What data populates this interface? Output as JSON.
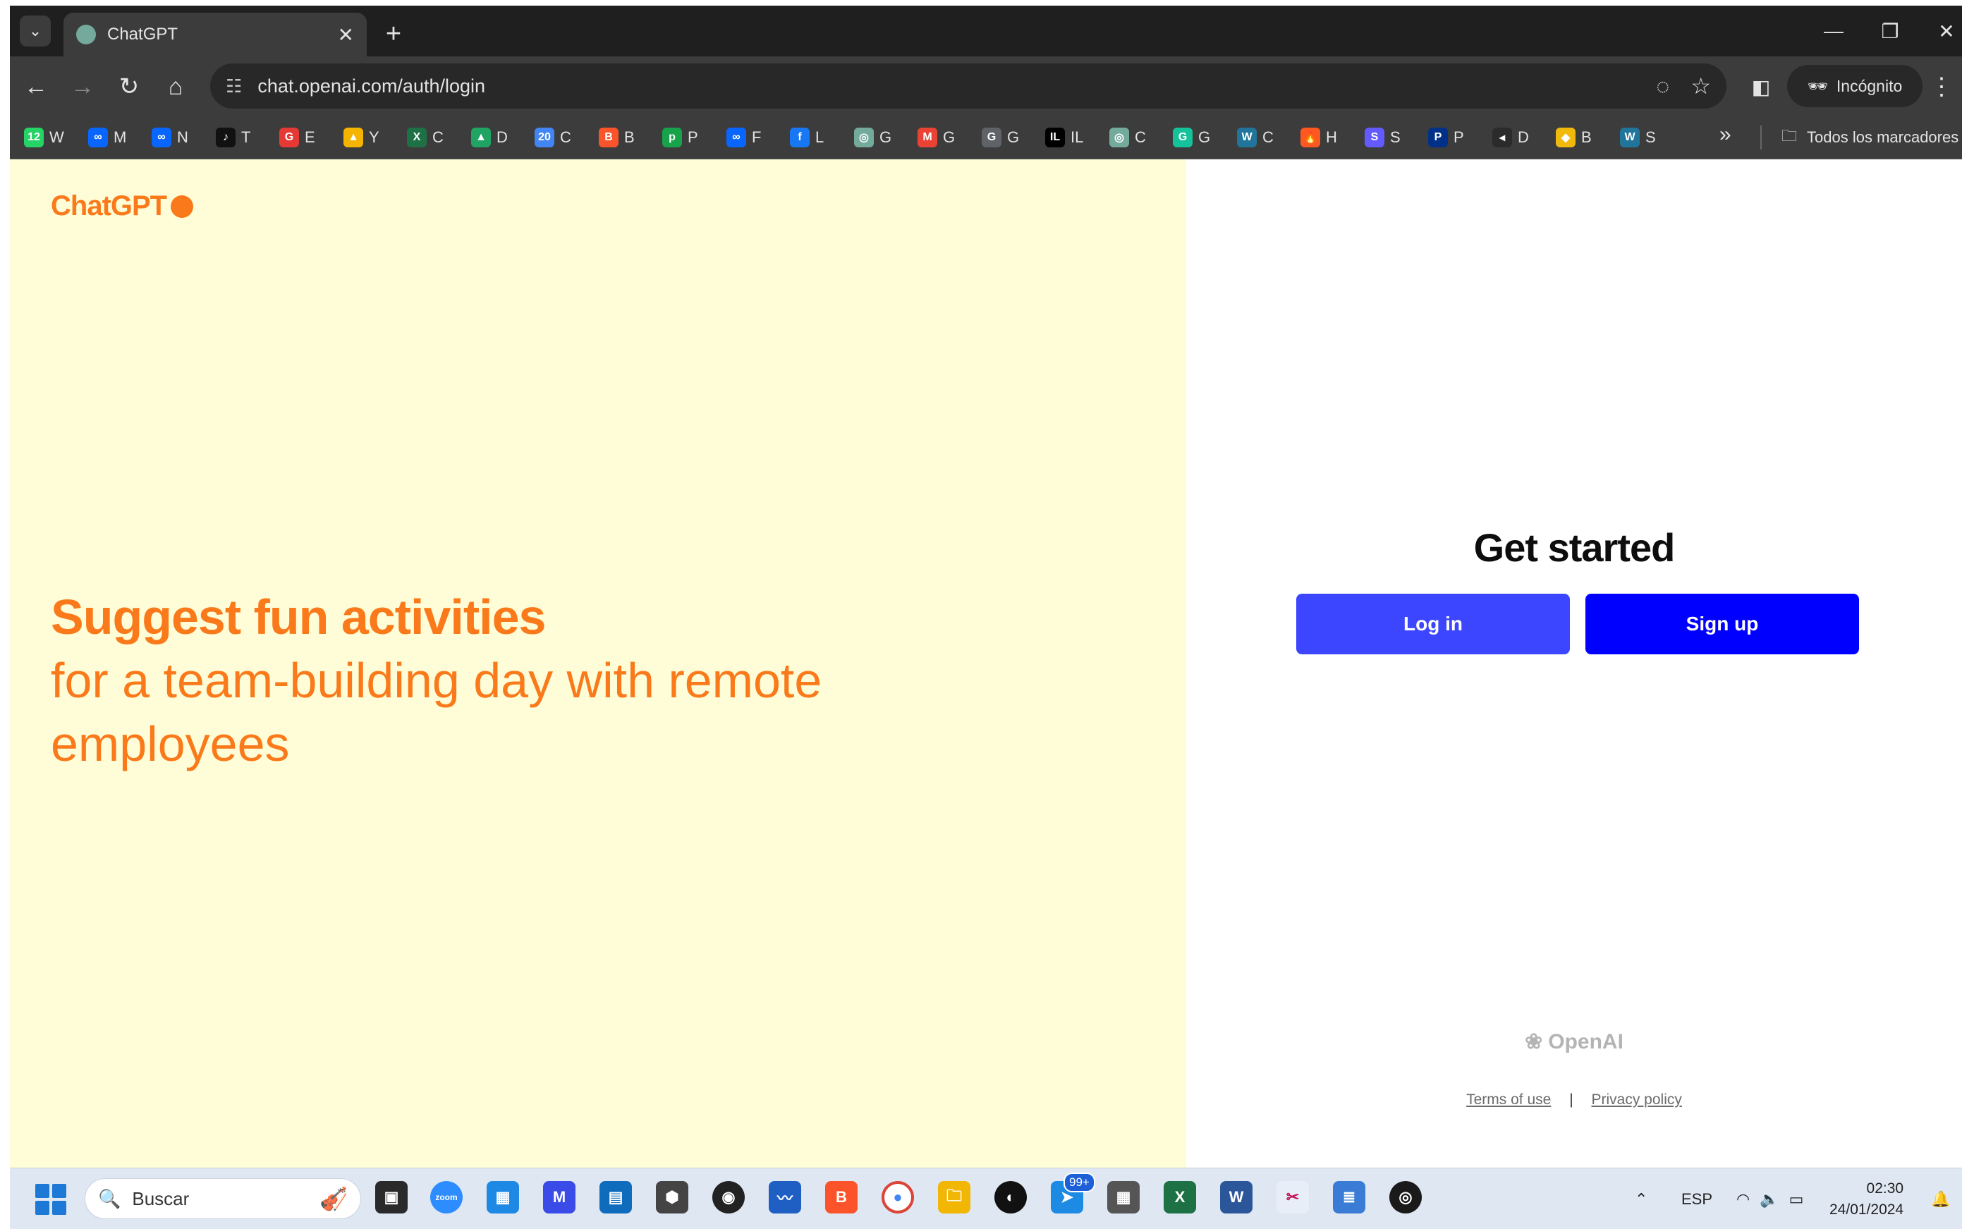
{
  "browser": {
    "tab_title": "ChatGPT",
    "url": "chat.openai.com/auth/login",
    "incognito_label": "Incógnito",
    "bookmarks": [
      {
        "label": "W",
        "icon": "whatsapp-icon",
        "color": "#25d366",
        "glyph": "12"
      },
      {
        "label": "M",
        "icon": "meta-icon",
        "color": "#0866ff",
        "glyph": "∞"
      },
      {
        "label": "N",
        "icon": "meta-icon",
        "color": "#0866ff",
        "glyph": "∞"
      },
      {
        "label": "T",
        "icon": "tiktok-icon",
        "color": "#111111",
        "glyph": "♪"
      },
      {
        "label": "E",
        "icon": "g-red-icon",
        "color": "#e53935",
        "glyph": "G"
      },
      {
        "label": "Y",
        "icon": "image-icon",
        "color": "#f5b400",
        "glyph": "▲"
      },
      {
        "label": "C",
        "icon": "spreadsheet-icon",
        "color": "#1e7145",
        "glyph": "X"
      },
      {
        "label": "D",
        "icon": "google-drive-icon",
        "color": "#1fa463",
        "glyph": "▲"
      },
      {
        "label": "C",
        "icon": "calendar-icon",
        "color": "#4285f4",
        "glyph": "20"
      },
      {
        "label": "B",
        "icon": "brave-icon",
        "color": "#fb542b",
        "glyph": "B"
      },
      {
        "label": "P",
        "icon": "p-green-icon",
        "color": "#16a34a",
        "glyph": "p"
      },
      {
        "label": "F",
        "icon": "meta-icon",
        "color": "#0866ff",
        "glyph": "∞"
      },
      {
        "label": "L",
        "icon": "facebook-icon",
        "color": "#1877f2",
        "glyph": "f"
      },
      {
        "label": "G",
        "icon": "chatgpt-icon",
        "color": "#74aa9c",
        "glyph": "◎"
      },
      {
        "label": "G",
        "icon": "gmail-icon",
        "color": "#ea4335",
        "glyph": "M"
      },
      {
        "label": "G",
        "icon": "google-icon",
        "color": "#5f6368",
        "glyph": "G"
      },
      {
        "label": "IL",
        "icon": "il-icon",
        "color": "#000000",
        "glyph": "IL"
      },
      {
        "label": "C",
        "icon": "chatgpt-icon",
        "color": "#74aa9c",
        "glyph": "◎"
      },
      {
        "label": "G",
        "icon": "grammarly-icon",
        "color": "#15c39a",
        "glyph": "G"
      },
      {
        "label": "C",
        "icon": "wordpress-icon",
        "color": "#21759b",
        "glyph": "W"
      },
      {
        "label": "H",
        "icon": "flame-icon",
        "color": "#ff5722",
        "glyph": "🔥"
      },
      {
        "label": "S",
        "icon": "s-purple-icon",
        "color": "#635bff",
        "glyph": "S"
      },
      {
        "label": "P",
        "icon": "paypal-icon",
        "color": "#003087",
        "glyph": "P"
      },
      {
        "label": "D",
        "icon": "d-icon",
        "color": "#2b2b2b",
        "glyph": "◂"
      },
      {
        "label": "B",
        "icon": "binance-icon",
        "color": "#f0b90b",
        "glyph": "◆"
      },
      {
        "label": "S",
        "icon": "wordpress-icon",
        "color": "#21759b",
        "glyph": "W"
      }
    ],
    "all_bookmarks_label": "Todos los marcadores"
  },
  "page": {
    "logo_text": "ChatGPT",
    "headline_bold": "Suggest fun activities",
    "headline_rest": "for a team-building day with remote employees",
    "get_started": "Get started",
    "login_button": "Log in",
    "signup_button": "Sign up",
    "openai_brand": "OpenAI",
    "terms_link": "Terms of use",
    "separator": "|",
    "privacy_link": "Privacy policy",
    "accent_color": "#fa7a1b",
    "left_bg_color": "#fefdd7"
  },
  "taskbar": {
    "search_placeholder": "Buscar",
    "notification_badge": "99+",
    "language": "ESP",
    "time": "02:30",
    "date": "24/01/2024"
  }
}
